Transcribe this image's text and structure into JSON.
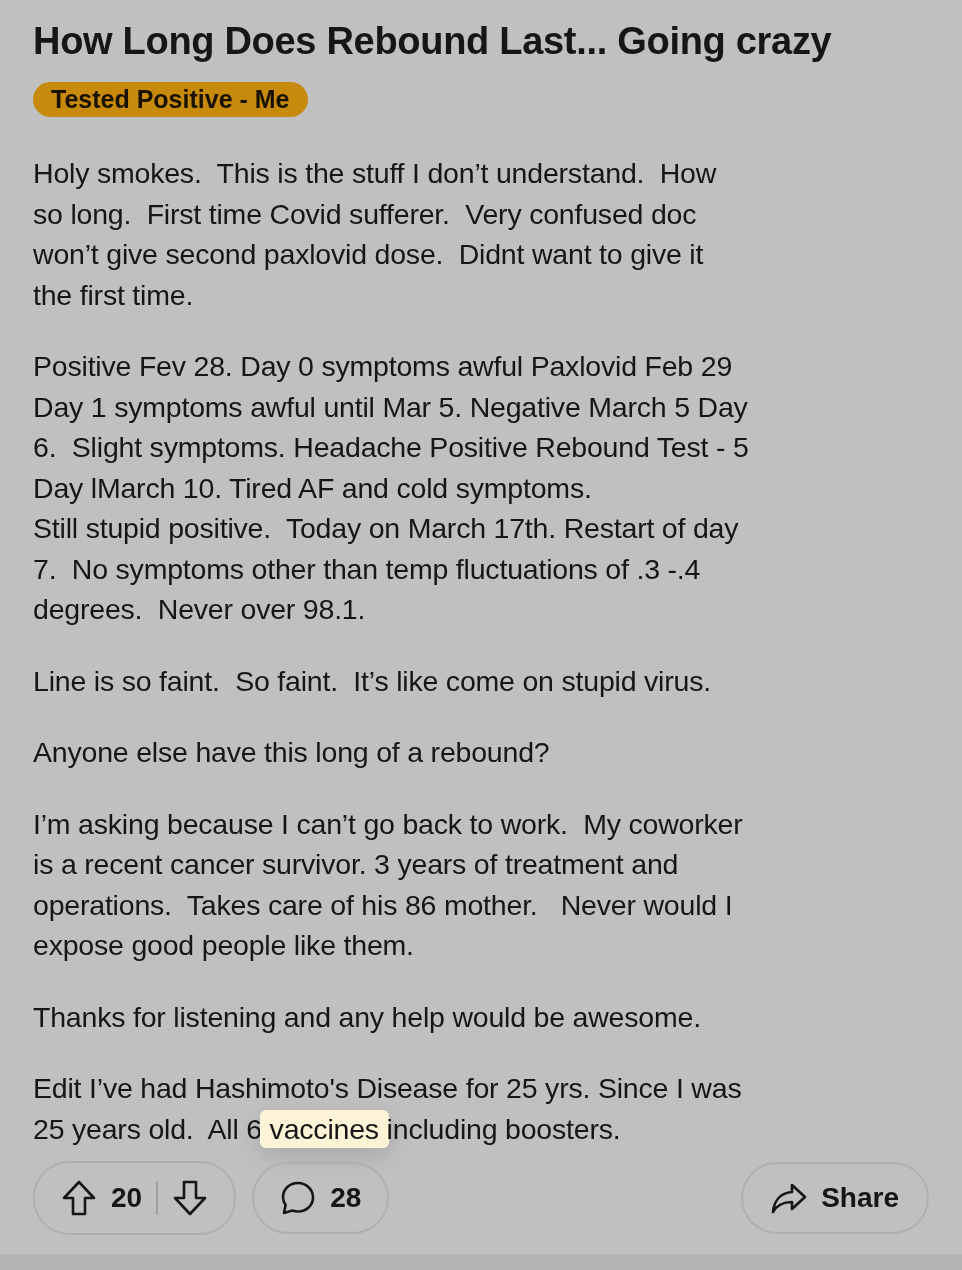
{
  "post": {
    "title": "How Long Does Rebound Last... Going crazy",
    "flair": {
      "label": "Tested Positive - Me",
      "color": "#c88a0c"
    },
    "paragraphs": [
      {
        "text": "Holy smokes.  This is the stuff I don’t understand.  How\nso long.  First time Covid sufferer.  Very confused doc\nwon’t give second paxlovid dose.  Didnt want to give it\nthe first time."
      },
      {
        "text": "Positive Fev 28. Day 0 symptoms awful Paxlovid Feb 29\nDay 1 symptoms awful until Mar 5. Negative March 5 Day\n6.  Slight symptoms. Headache Positive Rebound Test - 5\nDay lMarch 10. Tired AF and cold symptoms.\nStill stupid positive.  Today on March 17th. Restart of day\n7.  No symptoms other than temp fluctuations of .3 -.4\ndegrees.  Never over 98.1."
      },
      {
        "text": "Line is so faint.  So faint.  It’s like come on stupid virus."
      },
      {
        "text": "Anyone else have this long of a rebound?"
      },
      {
        "text": "I’m asking because I can’t go back to work.  My coworker\nis a recent cancer survivor. 3 years of treatment and\noperations.  Takes care of his 86 mother.   Never would I\nexpose good people like them."
      },
      {
        "text": "Thanks for listening and any help would be awesome."
      },
      {
        "text": "Edit I’ve had Hashimoto's Disease for 25 yrs. Since I was\n25 years old.  All 6 ",
        "highlighted": "vaccines",
        "after": " including boosters."
      }
    ]
  },
  "actions": {
    "votes": "20",
    "comments": "28",
    "share": "Share"
  }
}
